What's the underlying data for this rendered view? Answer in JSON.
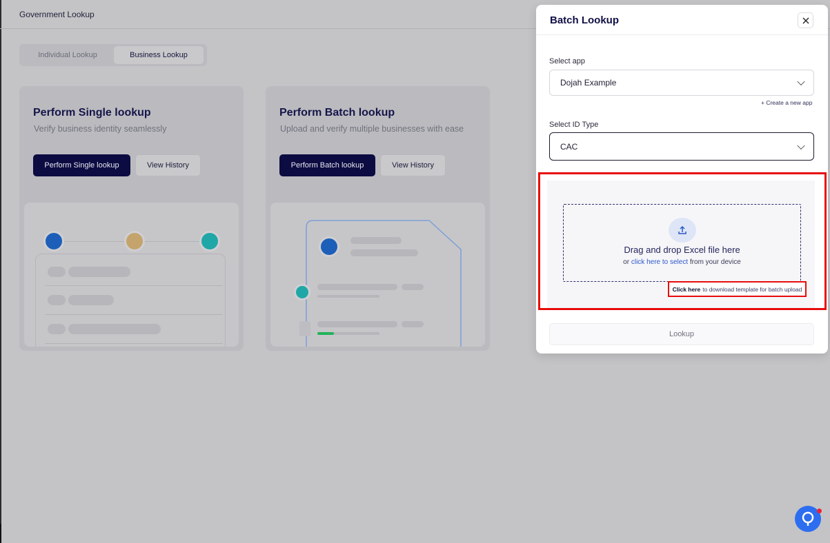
{
  "header": {
    "title": "Government Lookup"
  },
  "tabs": [
    {
      "label": "Individual Lookup",
      "active": false
    },
    {
      "label": "Business Lookup",
      "active": true
    }
  ],
  "cards": [
    {
      "title": "Perform Single lookup",
      "subtitle": "Verify business identity seamlessly",
      "primary_label": "Perform Single lookup",
      "secondary_label": "View History"
    },
    {
      "title": "Perform Batch lookup",
      "subtitle": "Upload and verify multiple businesses with ease",
      "primary_label": "Perform Batch lookup",
      "secondary_label": "View History"
    }
  ],
  "modal": {
    "title": "Batch Lookup",
    "close_icon": "close-icon",
    "app_label": "Select app",
    "app_value": "Dojah Example",
    "create_app_label": "+ Create a new app",
    "id_type_label": "Select ID Type",
    "id_type_value": "CAC",
    "upload_icon": "upload-icon",
    "drop_title": "Drag and drop Excel file here",
    "drop_sub_prefix": "or",
    "drop_sub_link": "click here to select",
    "drop_sub_suffix": "from your device",
    "template_link": "Click here",
    "template_text": "to download template for batch upload",
    "lookup_label": "Lookup"
  },
  "colors": {
    "overlay": "#c4c4c6",
    "primary": "#0c0c42",
    "highlight": "#e80b0b",
    "link": "#2f58c9",
    "chat": "#2d6df0"
  },
  "chat_icon": "chat-support-icon"
}
